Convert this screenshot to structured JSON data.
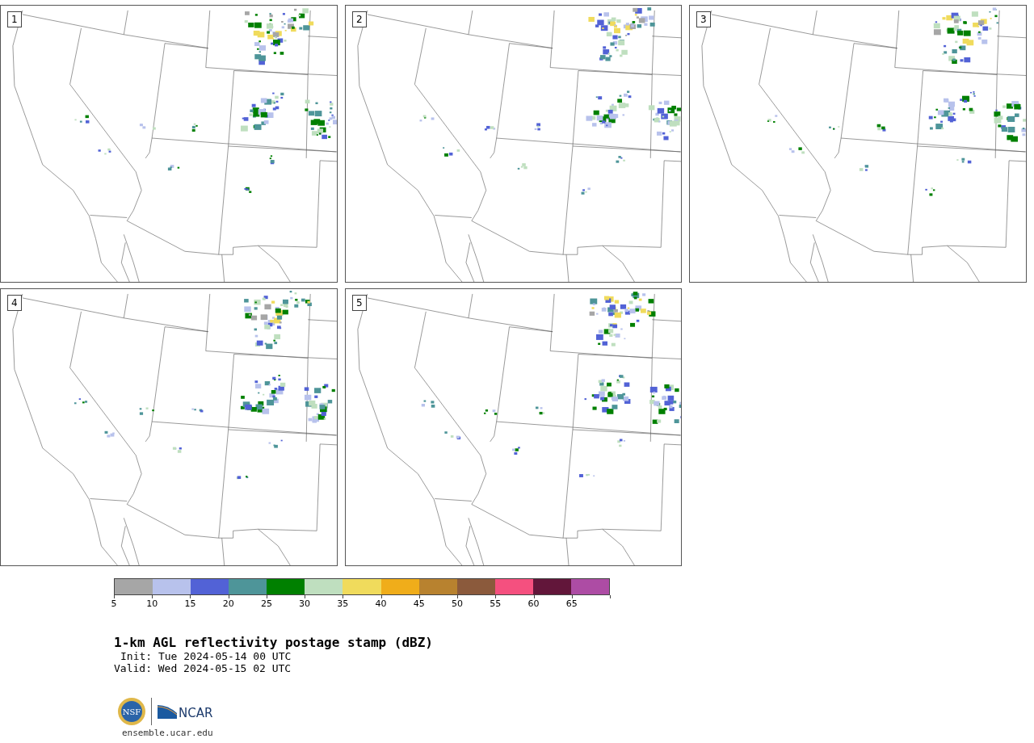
{
  "panels": [
    {
      "label": "1"
    },
    {
      "label": "2"
    },
    {
      "label": "3"
    },
    {
      "label": "4"
    },
    {
      "label": "5"
    }
  ],
  "colorbar": {
    "bins": [
      {
        "color": "#a6a6a6"
      },
      {
        "color": "#b8c2ec"
      },
      {
        "color": "#5262d6"
      },
      {
        "color": "#4e9599"
      },
      {
        "color": "#008000"
      },
      {
        "color": "#bfdfbf"
      },
      {
        "color": "#f0db5c"
      },
      {
        "color": "#f0ad1a"
      },
      {
        "color": "#b8822f"
      },
      {
        "color": "#8b5a3c"
      },
      {
        "color": "#f5507f"
      },
      {
        "color": "#62163a"
      },
      {
        "color": "#ad4ca4"
      }
    ],
    "ticks": [
      "5",
      "10",
      "15",
      "20",
      "25",
      "30",
      "35",
      "40",
      "45",
      "50",
      "55",
      "60",
      "65"
    ]
  },
  "title": "1-km AGL reflectivity postage stamp (dBZ)",
  "init": "Init: Tue 2024-05-14 00 UTC",
  "valid": "Valid: Wed 2024-05-15 02 UTC",
  "logos": {
    "nsf": "NSF",
    "ncar": "NCAR"
  },
  "url": "ensemble.ucar.edu"
}
